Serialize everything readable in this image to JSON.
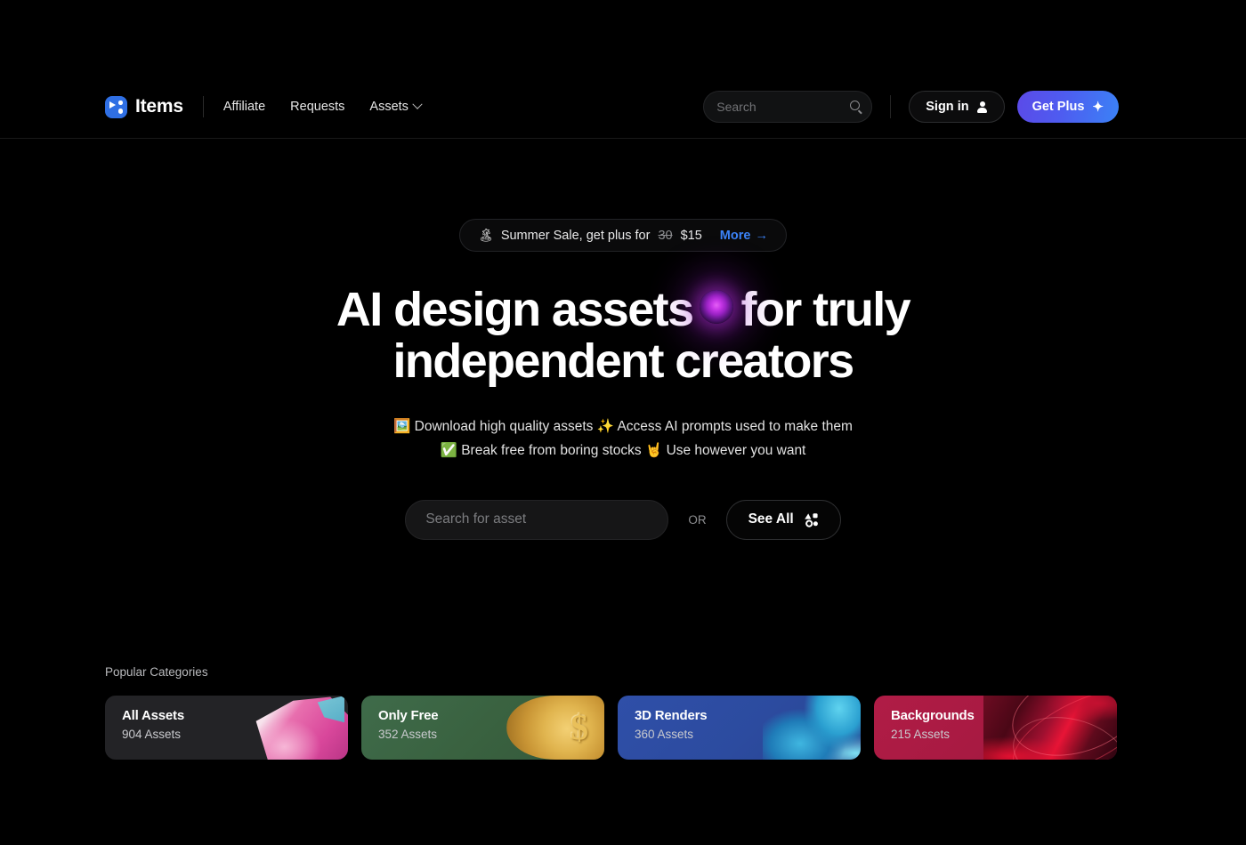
{
  "navbar": {
    "logo_text": "Items",
    "links": [
      {
        "label": "Affiliate",
        "has_chevron": false
      },
      {
        "label": "Requests",
        "has_chevron": false
      },
      {
        "label": "Assets",
        "has_chevron": true
      }
    ],
    "search_placeholder": "Search",
    "search_value": "",
    "signin_label": "Sign in",
    "getplus_label": "Get Plus",
    "getplus_gradient_from": "#5b4ae8",
    "getplus_gradient_to": "#3b82f6"
  },
  "hero": {
    "promo": {
      "emoji": "🏝",
      "text_before": "Summer Sale, get plus for",
      "old_price": "30",
      "new_price": "$15",
      "cta_label": "More",
      "cta_arrow": "→",
      "cta_color": "#3b82f6"
    },
    "headline_line1_before": "AI design assets",
    "headline_orb": "glowing-purple-orb",
    "headline_line1_after": "for truly",
    "headline_line2": "independent creators",
    "orb_color": "#c838e8",
    "subtitle_line1": "🖼️ Download high quality assets ✨ Access AI prompts used to make them",
    "subtitle_line2": "✅ Break free from boring stocks 🤘 Use however you want",
    "search_placeholder": "Search for asset",
    "search_value": "",
    "or_label": "OR",
    "see_all_label": "See All"
  },
  "categories": {
    "title": "Popular Categories",
    "cards": [
      {
        "name": "All Assets",
        "count": "904 Assets",
        "color": "#232326",
        "art": "pink-cube-render"
      },
      {
        "name": "Only Free",
        "count": "352 Assets",
        "color": "#3f6b4a",
        "art": "gold-dollar-coin"
      },
      {
        "name": "3D Renders",
        "count": "360 Assets",
        "color": "#2f4fa8",
        "art": "cyan-abstract-blob"
      },
      {
        "name": "Backgrounds",
        "count": "215 Assets",
        "color": "#b01c46",
        "art": "red-swoosh-background"
      }
    ]
  }
}
